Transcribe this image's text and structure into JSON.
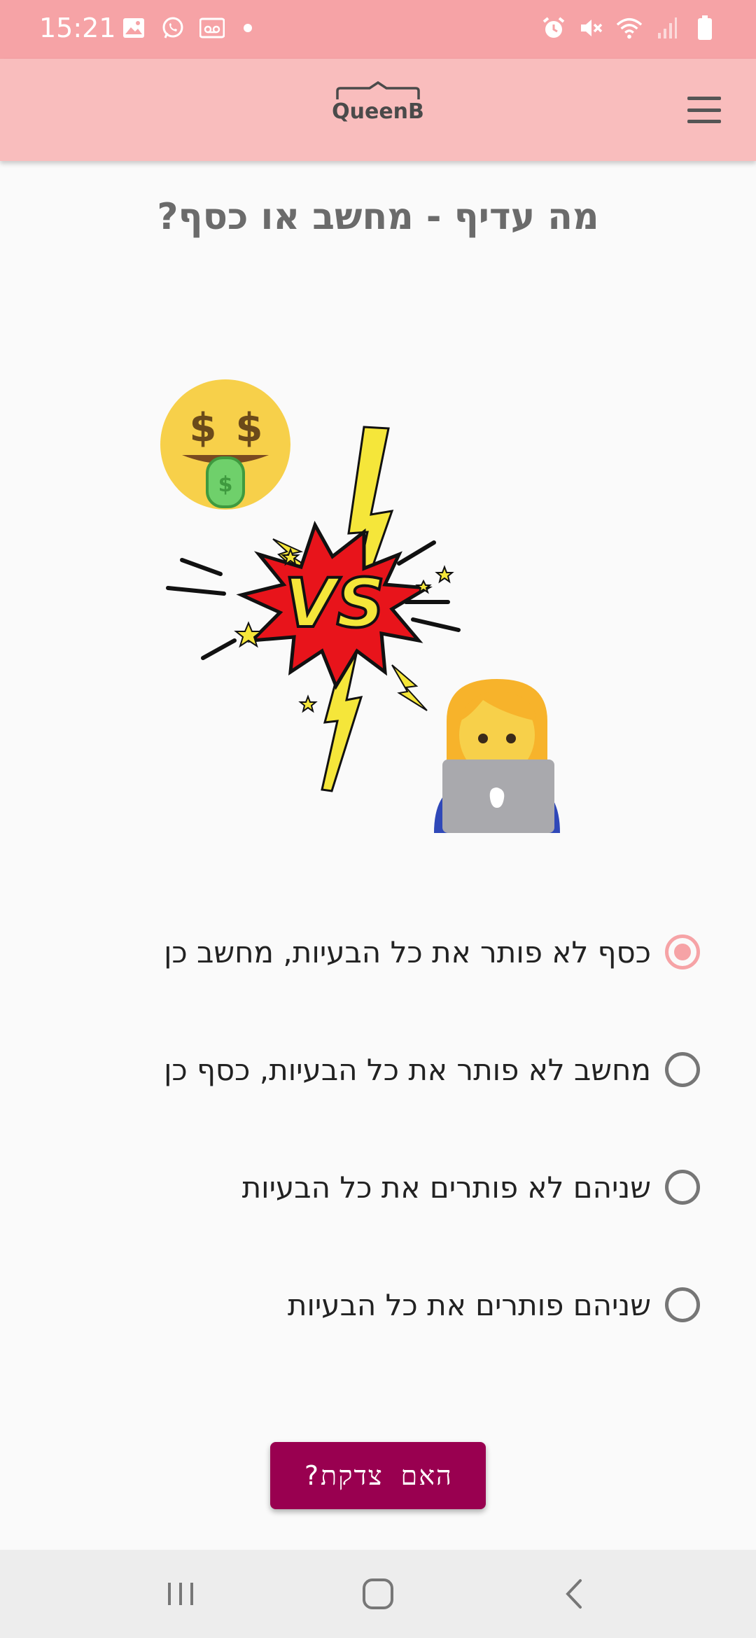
{
  "status_bar": {
    "time": "15:21",
    "left_icons": [
      "image-icon",
      "whatsapp-icon",
      "voicemail-icon"
    ],
    "right_icons": [
      "alarm-icon",
      "mute-icon",
      "wifi-icon",
      "signal-icon",
      "battery-icon"
    ]
  },
  "app_bar": {
    "logo_text": "QueenB",
    "menu_icon": "hamburger-menu-icon",
    "background": "#f9bdbd"
  },
  "question": {
    "title": "מה עדיף - מחשב או כסף?"
  },
  "illustration": {
    "icons": [
      "money-mouth-face-icon",
      "vs-burst-icon",
      "lightning-icon",
      "woman-technologist-icon"
    ],
    "vs_text": "VS"
  },
  "options": [
    {
      "label": "כסף לא פותר את כל הבעיות, מחשב כן",
      "selected": true
    },
    {
      "label": "מחשב לא פותר את כל הבעיות, כסף כן",
      "selected": false
    },
    {
      "label": "שניהם לא פותרים את כל הבעיות",
      "selected": false
    },
    {
      "label": "שניהם פותרים את כל הבעיות",
      "selected": false
    }
  ],
  "check_button": {
    "label": "האם צדקת?",
    "color": "#990050"
  },
  "colors": {
    "status_bar": "#f6a3a6",
    "accent": "#f6a3a6",
    "nav_bar": "#ededed"
  },
  "nav_bar": {
    "icons": [
      "recent-apps-icon",
      "home-icon",
      "back-icon"
    ]
  }
}
